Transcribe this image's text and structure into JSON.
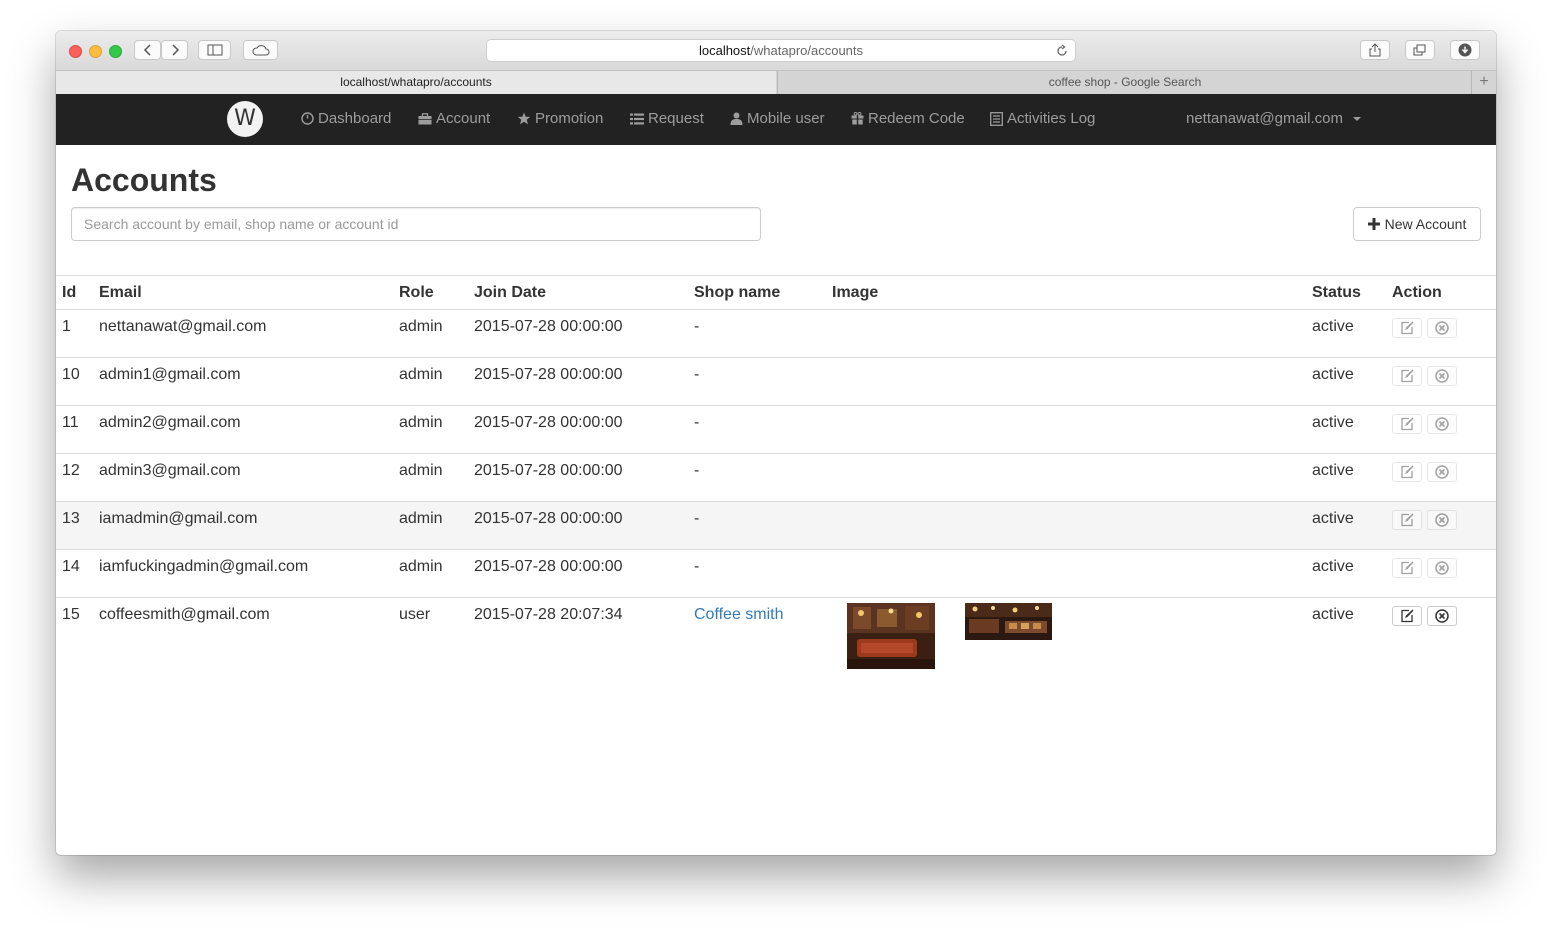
{
  "browser": {
    "url_host": "localhost",
    "url_path": "/whatapro/accounts",
    "tabs": [
      {
        "label": "localhost/whatapro/accounts"
      },
      {
        "label": "coffee shop - Google Search"
      }
    ]
  },
  "navbar": {
    "brand": "W",
    "items": [
      {
        "label": "Dashboard",
        "icon": "dashboard-icon"
      },
      {
        "label": "Account",
        "icon": "briefcase-icon"
      },
      {
        "label": "Promotion",
        "icon": "star-icon"
      },
      {
        "label": "Request",
        "icon": "list-icon"
      },
      {
        "label": "Mobile user",
        "icon": "user-icon"
      },
      {
        "label": "Redeem Code",
        "icon": "gift-icon"
      },
      {
        "label": "Activities Log",
        "icon": "log-icon"
      }
    ],
    "user_email": "nettanawat@gmail.com"
  },
  "page": {
    "title": "Accounts",
    "search_placeholder": "Search account by email, shop name or account id",
    "new_button": "New Account"
  },
  "table": {
    "headers": {
      "id": "Id",
      "email": "Email",
      "role": "Role",
      "join_date": "Join Date",
      "shop_name": "Shop name",
      "image": "Image",
      "status": "Status",
      "action": "Action"
    },
    "rows": [
      {
        "id": "1",
        "email": "nettanawat@gmail.com",
        "role": "admin",
        "join_date": "2015-07-28 00:00:00",
        "shop_name": "-",
        "status": "active"
      },
      {
        "id": "10",
        "email": "admin1@gmail.com",
        "role": "admin",
        "join_date": "2015-07-28 00:00:00",
        "shop_name": "-",
        "status": "active"
      },
      {
        "id": "11",
        "email": "admin2@gmail.com",
        "role": "admin",
        "join_date": "2015-07-28 00:00:00",
        "shop_name": "-",
        "status": "active"
      },
      {
        "id": "12",
        "email": "admin3@gmail.com",
        "role": "admin",
        "join_date": "2015-07-28 00:00:00",
        "shop_name": "-",
        "status": "active"
      },
      {
        "id": "13",
        "email": "iamadmin@gmail.com",
        "role": "admin",
        "join_date": "2015-07-28 00:00:00",
        "shop_name": "-",
        "status": "active"
      },
      {
        "id": "14",
        "email": "iamfuckingadmin@gmail.com",
        "role": "admin",
        "join_date": "2015-07-28 00:00:00",
        "shop_name": "-",
        "status": "active"
      },
      {
        "id": "15",
        "email": "coffeesmith@gmail.com",
        "role": "user",
        "join_date": "2015-07-28 20:07:34",
        "shop_name": "Coffee smith",
        "status": "active"
      }
    ]
  },
  "colors": {
    "navbar_bg": "#222222",
    "navbar_text": "#9d9d9d",
    "link": "#337ab7"
  }
}
